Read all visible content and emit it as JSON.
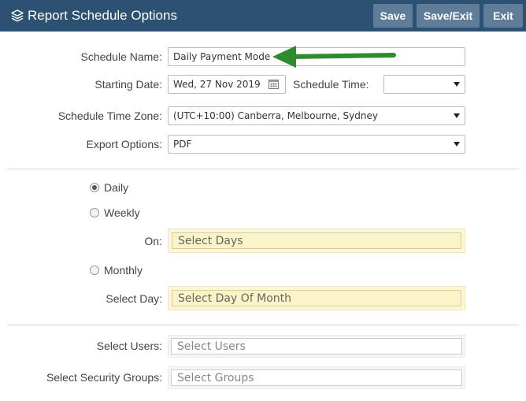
{
  "header": {
    "title": "Report Schedule Options",
    "save_label": "Save",
    "save_exit_label": "Save/Exit",
    "exit_label": "Exit"
  },
  "form": {
    "schedule_name_label": "Schedule Name:",
    "schedule_name_value": "Daily Payment Mode",
    "starting_date_label": "Starting Date:",
    "starting_date_value": "Wed, 27 Nov 2019",
    "schedule_time_label": "Schedule Time:",
    "schedule_time_value": "",
    "time_zone_label": "Schedule Time Zone:",
    "time_zone_value": "(UTC+10:00) Canberra, Melbourne, Sydney",
    "export_options_label": "Export Options:",
    "export_options_value": "PDF"
  },
  "frequency": {
    "daily_label": "Daily",
    "weekly_label": "Weekly",
    "on_label": "On:",
    "select_days_placeholder": "Select Days",
    "monthly_label": "Monthly",
    "select_day_label": "Select Day:",
    "select_day_of_month_placeholder": "Select Day Of Month",
    "selected": "Daily"
  },
  "recipients": {
    "select_users_label": "Select Users:",
    "select_users_placeholder": "Select Users",
    "select_groups_label": "Select Security Groups:",
    "select_groups_placeholder": "Select Groups"
  },
  "colors": {
    "header_bg": "#2d5170",
    "button_bg": "#5f7d99",
    "arrow": "#2e8b2e",
    "highlight": "#fbf4c8"
  }
}
